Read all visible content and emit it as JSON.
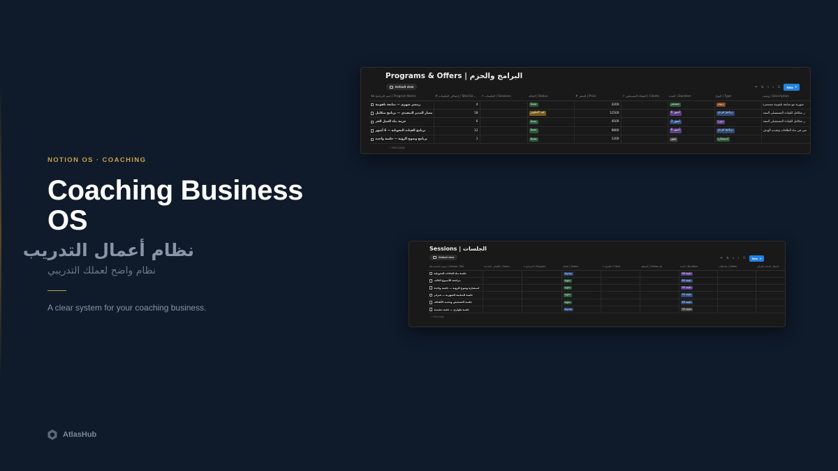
{
  "hero": {
    "kicker": "NOTION OS · COACHING",
    "title": "Coaching Business OS",
    "arabic_title": "نظام أعمال التدريب",
    "arabic_subtitle": "نظام واضح لعملك التدريبي",
    "tagline": "A clear system for your coaching business."
  },
  "brand": {
    "name": "AtlasHub",
    "icon": "hexagon-logo-icon"
  },
  "programs": {
    "title": "Programs & Offers | البرامج والحزم",
    "view": "Default view",
    "new_label": "New",
    "columns": [
      "Aa اسم البرنامج | Program Name",
      "# إجمالي الجلسات | Total Se...",
      "↗ الجلسات | Sessions",
      "الحالة | Status",
      "# السعر | Price",
      "↗ العملاء المسجلين | Clients",
      "المدة | Duration",
      "النوع | Type",
      "وصف | Description"
    ],
    "rows": [
      {
        "name": "زيتشر شهري — متابعة تلفونية",
        "total": "4",
        "sessions": "",
        "status": "نشط",
        "status_color": "#2d5a3c",
        "price": "2200",
        "clients": "",
        "duration": "مستمر",
        "duration_color": "#2d5a3c",
        "type": "زبونر",
        "type_color": "#8a4a1e",
        "description": "شهرية مع متابعة تلفونية مستمرة"
      },
      {
        "name": "مسار المدير التنفيذي — برنامج متكامل",
        "total": "18",
        "sessions": "",
        "status": "قيد التطوير",
        "status_color": "#7a5a1a",
        "price": "12500",
        "clients": "",
        "duration": "أشهر 6",
        "duration_color": "#5a3f8a",
        "type": "برنامج فردي",
        "type_color": "#2e4a7a",
        "description": "ر متكامل للقيادة المستقبلي التنفذ"
      },
      {
        "name": "حزمة بناء العمل الحر",
        "total": "6",
        "sessions": "",
        "status": "نشط",
        "status_color": "#2d5a3c",
        "price": "4500",
        "clients": "",
        "duration": "أشهر 3",
        "duration_color": "#2e4a7a",
        "type": "دورة",
        "type_color": "#5a3f8a",
        "description": "ر متكامل للقيادة المستقبلي التنفذ"
      },
      {
        "name": "برنامج القيادة التحويلية — 6 أشهر",
        "total": "12",
        "sessions": "",
        "status": "نشط",
        "status_color": "#2d5a3c",
        "price": "9800",
        "clients": "",
        "duration": "أشهر 6",
        "duration_color": "#5a3f8a",
        "type": "برنامج فردي",
        "type_color": "#2e4a7a",
        "description": "تعن في بناء الطاقات وتحديد الهدف"
      },
      {
        "name": "برنامج وضوح الرؤية — جلسة واحدة",
        "total": "1",
        "sessions": "",
        "status": "نشط",
        "status_color": "#2d5a3c",
        "price": "1200",
        "clients": "",
        "duration": "شهر",
        "duration_color": "#4a4a4a",
        "type": "استشارة",
        "type_color": "#2d5a3c",
        "description": ""
      }
    ],
    "new_page": "+ New page"
  },
  "sessions": {
    "title": "Sessions | الجلسات",
    "view": "Default view",
    "new_label": "New",
    "columns": [
      "Aa عنوان الجلسة | Session Title",
      "الأهداف المحددة | Goals...",
      "↗ البرنامج | Program",
      "الحالة | Status",
      "↗ العميل | Client",
      "المتابعة | Follow-up",
      "المدة | Duration",
      "ملاحظات | Notes",
      "المجال المحدد للتركيز"
    ],
    "rows": [
      {
        "name": "جلسة بناء العادات التحويلية",
        "status": "مجدولة",
        "status_color": "#2e4a7a",
        "duration": "دقيقة 90",
        "duration_color": "#5a3f8a"
      },
      {
        "name": "مراجعة الأسبوع الثالث",
        "status": "منتهية",
        "status_color": "#2d5a3c",
        "duration": "دقيقة 60",
        "duration_color": "#2e4a7a"
      },
      {
        "name": "استشارة وضوح الرؤية — جلسة واحدة",
        "status": "منتهية",
        "status_color": "#2d5a3c",
        "duration": "دقيقة 90",
        "duration_color": "#5a3f8a"
      },
      {
        "name": "جلسة المتابعة الشهرية — فبراير",
        "status": "منتهية",
        "status_color": "#2d5a3c",
        "duration": "دقيقة 45",
        "duration_color": "#2e4a7a"
      },
      {
        "name": "جلسة التشخيص وتحديد الأهداف",
        "status": "منتهية",
        "status_color": "#2d5a3c",
        "duration": "دقيقة 60",
        "duration_color": "#2e4a7a"
      },
      {
        "name": "جلسة طوارئ — عقبة تنفيذية",
        "status": "مجدولة",
        "status_color": "#2e4a7a",
        "duration": "دقيقة 30",
        "duration_color": "#4a4a4a"
      }
    ],
    "new_page": "+ New page"
  }
}
